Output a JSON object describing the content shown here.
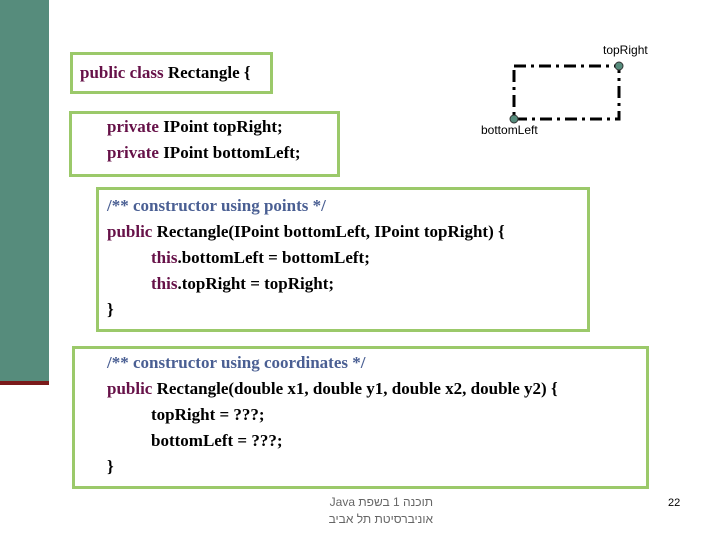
{
  "slide": {
    "page_number": "22",
    "footer": {
      "line1": "תוכנה 1 בשפת Java",
      "line2": "אוניברסיטת תל אביב"
    }
  },
  "diagram": {
    "top_right_label": "topRight",
    "bottom_left_label": "bottomLeft"
  },
  "code": {
    "class_decl": {
      "kw": "public class",
      "name": " Rectangle",
      "brace": " {"
    },
    "fields": [
      {
        "kw": "private",
        "rest": " IPoint topRight;"
      },
      {
        "kw": "private",
        "rest": " IPoint bottomLeft;"
      }
    ],
    "ctor1": {
      "comment": "/** constructor using points */",
      "sig_kw": "public",
      "sig_rest": " Rectangle(IPoint bottomLeft, IPoint topRight) {",
      "body": [
        {
          "kw": "this",
          "rest": ".bottomLeft = bottomLeft;"
        },
        {
          "kw": "this",
          "rest": ".topRight = topRight;"
        }
      ],
      "close": "}"
    },
    "ctor2": {
      "comment": "/** constructor using coordinates */",
      "sig_kw": "public",
      "sig_rest": " Rectangle(double x1, double y1, double x2, double y2) {",
      "body": [
        "topRight = ???;",
        "bottomLeft = ???;"
      ],
      "close": "}"
    }
  },
  "colors": {
    "sidebar": "#568c7c",
    "box_border": "#9bc96a",
    "keyword": "#661148",
    "comment": "#4a5f93"
  }
}
